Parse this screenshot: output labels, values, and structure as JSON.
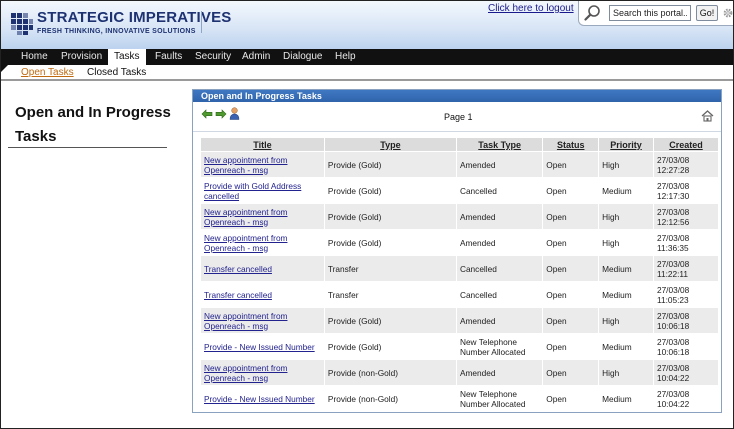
{
  "brand": {
    "title": "STRATEGIC IMPERATIVES",
    "tagline": "FRESH THINKING, INNOVATIVE SOLUTIONS"
  },
  "header": {
    "logout_label": "Click here to logout",
    "search_placeholder": "Search this portal...",
    "go_label": "Go!"
  },
  "nav": {
    "items": [
      "Home",
      "Provision",
      "Tasks",
      "Faults",
      "Security",
      "Admin",
      "Dialogue",
      "Help"
    ],
    "active": "Tasks"
  },
  "subnav": {
    "items": [
      "Open Tasks",
      "Closed Tasks"
    ],
    "active": "Open Tasks"
  },
  "page": {
    "title": "Open and In Progress Tasks"
  },
  "panel": {
    "title": "Open and In Progress Tasks",
    "page_label": "Page 1"
  },
  "table": {
    "columns": [
      "Title",
      "Type",
      "Task Type",
      "Status",
      "Priority",
      "Created"
    ],
    "rows": [
      {
        "title": "New appointment from Openreach - msg",
        "type": "Provide (Gold)",
        "task_type": "Amended",
        "status": "Open",
        "priority": "High",
        "created": "27/03/08 12:27:28"
      },
      {
        "title": "Provide with Gold Address cancelled",
        "type": "Provide (Gold)",
        "task_type": "Cancelled",
        "status": "Open",
        "priority": "Medium",
        "created": "27/03/08 12:17:30"
      },
      {
        "title": "New appointment from Openreach - msg",
        "type": "Provide (Gold)",
        "task_type": "Amended",
        "status": "Open",
        "priority": "High",
        "created": "27/03/08 12:12:56"
      },
      {
        "title": "New appointment from Openreach - msg",
        "type": "Provide (Gold)",
        "task_type": "Amended",
        "status": "Open",
        "priority": "High",
        "created": "27/03/08 11:36:35"
      },
      {
        "title": "Transfer cancelled",
        "type": "Transfer",
        "task_type": "Cancelled",
        "status": "Open",
        "priority": "Medium",
        "created": "27/03/08 11:22:11"
      },
      {
        "title": "Transfer cancelled",
        "type": "Transfer",
        "task_type": "Cancelled",
        "status": "Open",
        "priority": "Medium",
        "created": "27/03/08 11:05:23"
      },
      {
        "title": "New appointment from Openreach - msg",
        "type": "Provide (Gold)",
        "task_type": "Amended",
        "status": "Open",
        "priority": "High",
        "created": "27/03/08 10:06:18"
      },
      {
        "title": "Provide - New Issued Number",
        "type": "Provide (Gold)",
        "task_type": "New Telephone Number Allocated",
        "status": "Open",
        "priority": "Medium",
        "created": "27/03/08 10:06:18"
      },
      {
        "title": "New appointment from Openreach - msg",
        "type": "Provide (non-Gold)",
        "task_type": "Amended",
        "status": "Open",
        "priority": "High",
        "created": "27/03/08 10:04:22"
      },
      {
        "title": "Provide - New Issued Number",
        "type": "Provide (non-Gold)",
        "task_type": "New Telephone Number Allocated",
        "status": "Open",
        "priority": "Medium",
        "created": "27/03/08 10:04:22"
      }
    ]
  },
  "icons": {
    "back": "left-arrow-icon",
    "forward": "right-arrow-icon",
    "user": "user-icon",
    "home": "home-icon",
    "search": "magnifier-icon",
    "settings": "gear-icon"
  },
  "colors": {
    "brand_navy": "#1e3272",
    "nav_bg": "#111111",
    "panel_header": "#3f78c2",
    "active_subnav": "#c06a10",
    "link": "#23238f"
  }
}
